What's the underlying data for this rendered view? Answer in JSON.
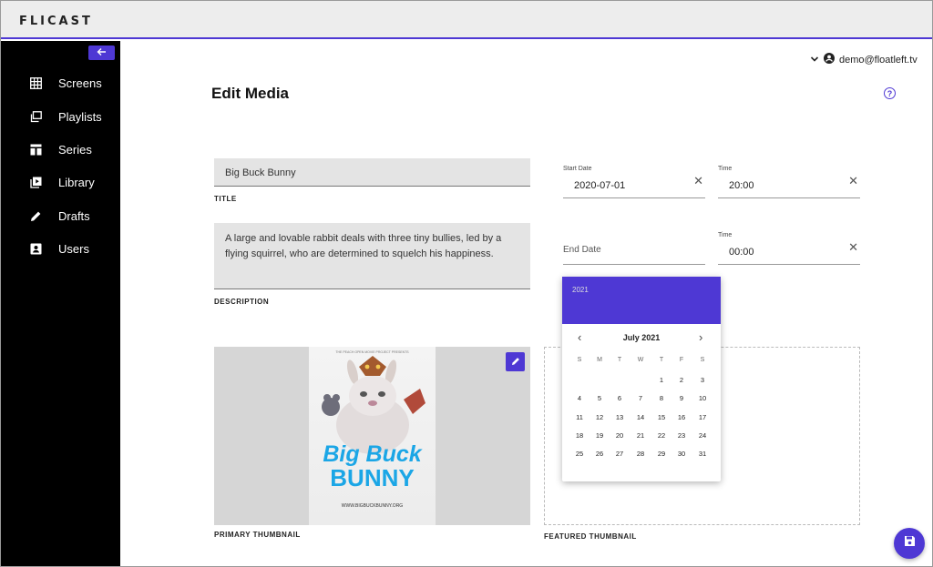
{
  "app": {
    "logo_text": "FLICAST"
  },
  "sidebar": {
    "items": [
      {
        "label": "Screens",
        "icon": "grid-icon"
      },
      {
        "label": "Playlists",
        "icon": "playlists-icon"
      },
      {
        "label": "Series",
        "icon": "series-icon"
      },
      {
        "label": "Library",
        "icon": "library-icon"
      },
      {
        "label": "Drafts",
        "icon": "pencil-icon"
      },
      {
        "label": "Users",
        "icon": "user-card-icon"
      }
    ]
  },
  "header": {
    "user_email": "demo@floatleft.tv",
    "page_title": "Edit Media"
  },
  "form": {
    "title_value": "Big Buck Bunny",
    "title_caption": "TITLE",
    "description_value": "A large and lovable rabbit deals with three tiny bullies, led by a flying squirrel, who are determined to squelch his happiness.",
    "description_caption": "DESCRIPTION",
    "start_date_label": "Start Date",
    "start_date_value": "2020-07-01",
    "start_time_label": "Time",
    "start_time_value": "20:00",
    "end_date_placeholder": "End Date",
    "end_time_label": "Time",
    "end_time_value": "00:00",
    "primary_thumb_caption": "PRIMARY THUMBNAIL",
    "featured_thumb_caption": "FEATURED THUMBNAIL"
  },
  "poster": {
    "top_text": "THE PEACH OPEN MOVIE PROJECT PRESENTS",
    "title_line1": "Big Buck",
    "title_line2": "BUNNY",
    "url": "WWW.BIGBUCKBUNNY.ORG"
  },
  "calendar": {
    "year": "2021",
    "month_label": "July 2021",
    "weekdays": [
      "S",
      "M",
      "T",
      "W",
      "T",
      "F",
      "S"
    ],
    "first_weekday_index": 4,
    "days_in_month": 31
  },
  "colors": {
    "accent": "#4e38d4",
    "sidebar_bg": "#000000",
    "field_bg": "#e4e4e4"
  }
}
